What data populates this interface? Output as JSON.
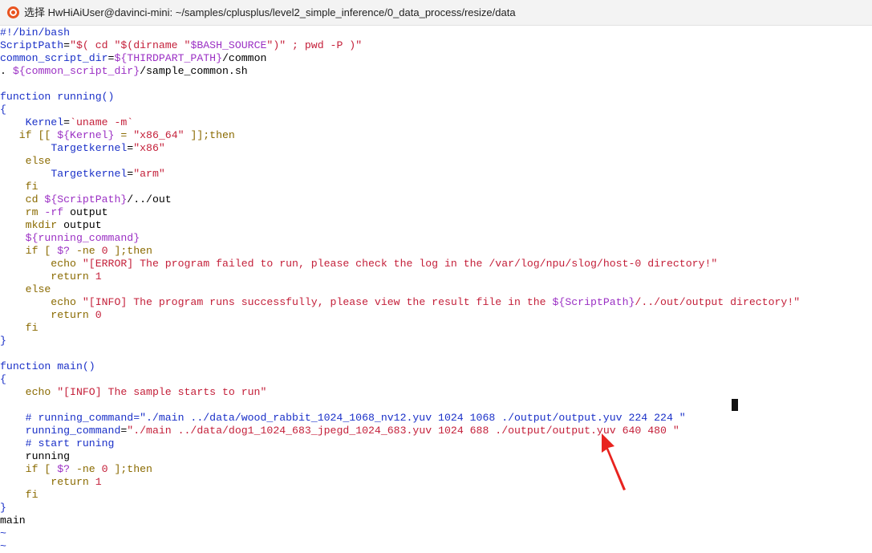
{
  "window": {
    "title": "选择 HwHiAiUser@davinci-mini: ~/samples/cplusplus/level2_simple_inference/0_data_process/resize/data"
  },
  "terminal": {
    "lines": [
      [
        {
          "t": "#!/bin/bash",
          "c": "blue"
        }
      ],
      [
        {
          "t": "ScriptPath",
          "c": "blue"
        },
        {
          "t": "=",
          "c": "black"
        },
        {
          "t": "\"$( cd \"$(dirname \"",
          "c": "red"
        },
        {
          "t": "$BASH_SOURCE",
          "c": "purple"
        },
        {
          "t": "\")\" ; pwd -P )\"",
          "c": "red"
        }
      ],
      [
        {
          "t": "common_script_dir",
          "c": "blue"
        },
        {
          "t": "=",
          "c": "black"
        },
        {
          "t": "${THIRDPART_PATH}",
          "c": "purple"
        },
        {
          "t": "/common",
          "c": "black"
        }
      ],
      [
        {
          "t": ". ",
          "c": "black"
        },
        {
          "t": "${common_script_dir}",
          "c": "purple"
        },
        {
          "t": "/sample_common.sh",
          "c": "black"
        }
      ],
      [],
      [
        {
          "t": "function running()",
          "c": "blue"
        }
      ],
      [
        {
          "t": "{",
          "c": "blue"
        }
      ],
      [
        {
          "t": "    ",
          "c": "black"
        },
        {
          "t": "Kernel",
          "c": "blue"
        },
        {
          "t": "=",
          "c": "black"
        },
        {
          "t": "`uname -m`",
          "c": "red"
        }
      ],
      [
        {
          "t": "   if [[ ",
          "c": "brown"
        },
        {
          "t": "${Kernel}",
          "c": "purple"
        },
        {
          "t": " = ",
          "c": "brown"
        },
        {
          "t": "\"x86_64\"",
          "c": "red"
        },
        {
          "t": " ]];then",
          "c": "brown"
        }
      ],
      [
        {
          "t": "        ",
          "c": "black"
        },
        {
          "t": "Targetkernel",
          "c": "blue"
        },
        {
          "t": "=",
          "c": "black"
        },
        {
          "t": "\"x86\"",
          "c": "red"
        }
      ],
      [
        {
          "t": "    else",
          "c": "brown"
        }
      ],
      [
        {
          "t": "        ",
          "c": "black"
        },
        {
          "t": "Targetkernel",
          "c": "blue"
        },
        {
          "t": "=",
          "c": "black"
        },
        {
          "t": "\"arm\"",
          "c": "red"
        }
      ],
      [
        {
          "t": "    fi",
          "c": "brown"
        }
      ],
      [
        {
          "t": "    cd ",
          "c": "brown"
        },
        {
          "t": "${ScriptPath}",
          "c": "purple"
        },
        {
          "t": "/../out",
          "c": "black"
        }
      ],
      [
        {
          "t": "    rm ",
          "c": "brown"
        },
        {
          "t": "-rf",
          "c": "purple"
        },
        {
          "t": " output",
          "c": "black"
        }
      ],
      [
        {
          "t": "    mkdir",
          "c": "brown"
        },
        {
          "t": " output",
          "c": "black"
        }
      ],
      [
        {
          "t": "    ${running_command}",
          "c": "purple"
        }
      ],
      [
        {
          "t": "    if [ ",
          "c": "brown"
        },
        {
          "t": "$?",
          "c": "purple"
        },
        {
          "t": " -ne ",
          "c": "brown"
        },
        {
          "t": "0",
          "c": "red"
        },
        {
          "t": " ];then",
          "c": "brown"
        }
      ],
      [
        {
          "t": "        echo ",
          "c": "brown"
        },
        {
          "t": "\"[ERROR] The program failed to run, please check the log in the /var/log/npu/slog/host-0 directory!\"",
          "c": "red"
        }
      ],
      [
        {
          "t": "        return ",
          "c": "brown"
        },
        {
          "t": "1",
          "c": "red"
        }
      ],
      [
        {
          "t": "    else",
          "c": "brown"
        }
      ],
      [
        {
          "t": "        echo ",
          "c": "brown"
        },
        {
          "t": "\"[INFO] The program runs successfully, please view the result file in the ",
          "c": "red"
        },
        {
          "t": "${ScriptPath}",
          "c": "purple"
        },
        {
          "t": "/../out/output directory!\"",
          "c": "red"
        }
      ],
      [
        {
          "t": "        return ",
          "c": "brown"
        },
        {
          "t": "0",
          "c": "red"
        }
      ],
      [
        {
          "t": "    fi",
          "c": "brown"
        }
      ],
      [
        {
          "t": "}",
          "c": "blue"
        }
      ],
      [],
      [
        {
          "t": "function main()",
          "c": "blue"
        }
      ],
      [
        {
          "t": "{",
          "c": "blue"
        }
      ],
      [
        {
          "t": "    echo ",
          "c": "brown"
        },
        {
          "t": "\"[INFO] The sample starts to run\"",
          "c": "red"
        }
      ],
      [],
      [
        {
          "t": "    # running_command=\"./main ../data/wood_rabbit_1024_1068_nv12.yuv 1024 1068 ./output/output.yuv 224 224 \"",
          "c": "blue"
        }
      ],
      [
        {
          "t": "    ",
          "c": "black"
        },
        {
          "t": "running_command",
          "c": "blue"
        },
        {
          "t": "=",
          "c": "black"
        },
        {
          "t": "\"./main ../data/dog1_1024_683_jpegd_1024_683.yuv 1024 688 ./output/output.yuv 640 480 \"",
          "c": "red"
        }
      ],
      [
        {
          "t": "    # start runing",
          "c": "blue"
        }
      ],
      [
        {
          "t": "    running",
          "c": "black"
        }
      ],
      [
        {
          "t": "    if [ ",
          "c": "brown"
        },
        {
          "t": "$?",
          "c": "purple"
        },
        {
          "t": " -ne ",
          "c": "brown"
        },
        {
          "t": "0",
          "c": "red"
        },
        {
          "t": " ];then",
          "c": "brown"
        }
      ],
      [
        {
          "t": "        return ",
          "c": "brown"
        },
        {
          "t": "1",
          "c": "red"
        }
      ],
      [
        {
          "t": "    fi",
          "c": "brown"
        }
      ],
      [
        {
          "t": "}",
          "c": "blue"
        }
      ],
      [
        {
          "t": "main",
          "c": "black"
        }
      ],
      [
        {
          "t": "~",
          "c": "blue"
        }
      ],
      [
        {
          "t": "~",
          "c": "blue"
        }
      ]
    ]
  },
  "annotation": {
    "arrow_color": "#e8231f"
  },
  "colors": {
    "blue": "#1a30c8",
    "purple": "#9b30c4",
    "red": "#c4203a",
    "brown": "#8a6a00",
    "black": "#000000"
  }
}
